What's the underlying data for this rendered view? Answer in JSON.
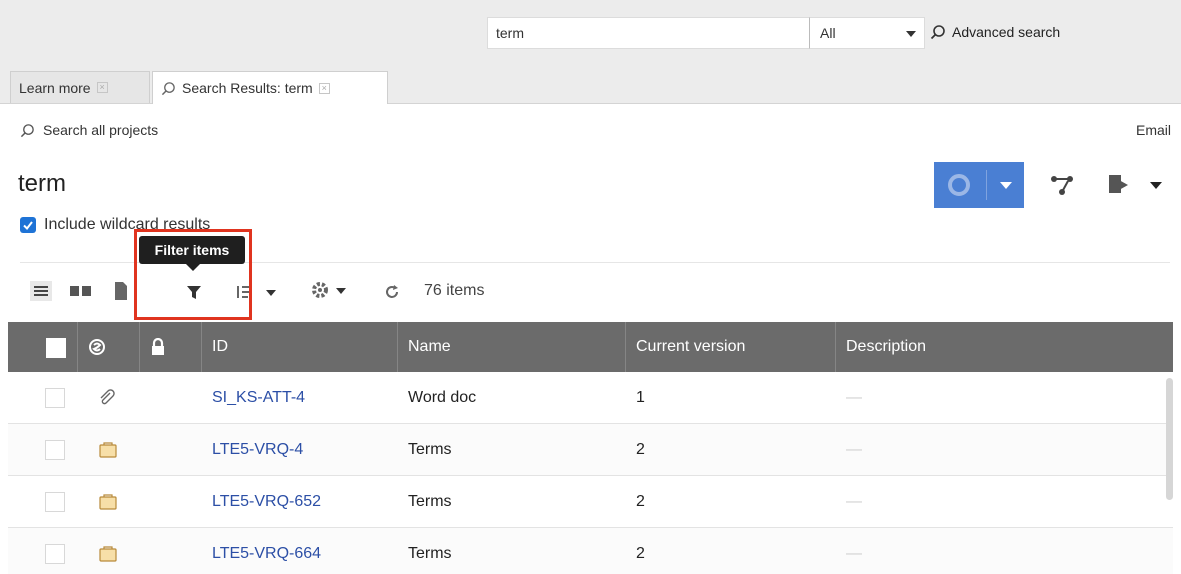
{
  "search": {
    "query": "term",
    "scope": "All",
    "advanced_label": "Advanced search"
  },
  "tabs": [
    {
      "label": "Learn more"
    },
    {
      "label": "Search Results: term"
    }
  ],
  "search_all_label": "Search all projects",
  "email_label": "Email",
  "page_title": "term",
  "wildcard_label": "Include wildcard results",
  "tooltip": "Filter items",
  "items_count": "76 items",
  "table": {
    "headers": {
      "id": "ID",
      "name": "Name",
      "version": "Current version",
      "description": "Description"
    },
    "rows": [
      {
        "icon": "paperclip-icon",
        "id": "SI_KS-ATT-4",
        "name": "Word doc",
        "version": "1",
        "description": "—"
      },
      {
        "icon": "folder-icon",
        "id": "LTE5-VRQ-4",
        "name": "Terms",
        "version": "2",
        "description": "—"
      },
      {
        "icon": "folder-icon",
        "id": "LTE5-VRQ-652",
        "name": "Terms",
        "version": "2",
        "description": "—"
      },
      {
        "icon": "folder-icon",
        "id": "LTE5-VRQ-664",
        "name": "Terms",
        "version": "2",
        "description": "—"
      }
    ]
  },
  "colors": {
    "header_bg": "#6b6b6b",
    "link": "#2c4fa6",
    "primary": "#4a7fd3",
    "highlight": "#e0341f",
    "checkbox": "#1e73d6"
  }
}
